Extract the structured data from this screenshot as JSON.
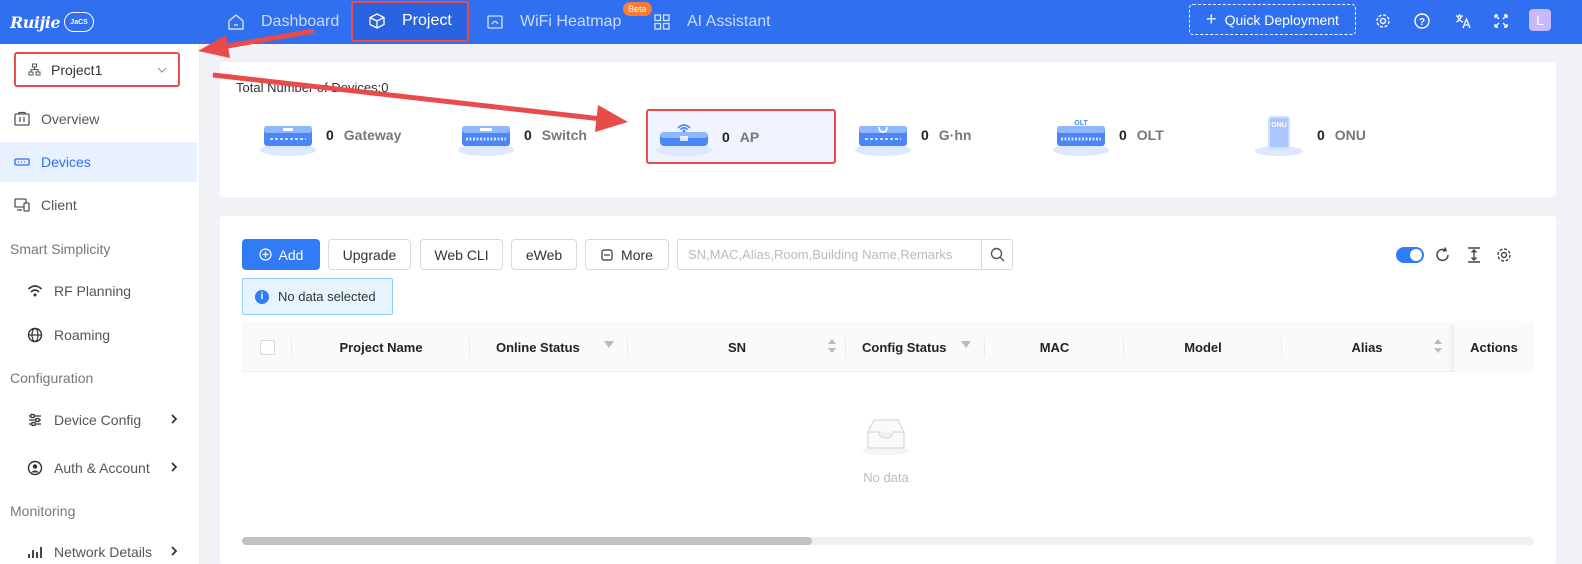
{
  "topbar": {
    "brand": "Ruijie",
    "cloud_label": "JaCS",
    "nav": [
      {
        "label": "Dashboard",
        "icon": "dashboard-icon"
      },
      {
        "label": "Project",
        "icon": "cube-icon"
      },
      {
        "label": "WiFi Heatmap",
        "icon": "heatmap-icon"
      },
      {
        "label": "AI Assistant",
        "icon": "grid-icon"
      }
    ],
    "beta_badge": "Beta",
    "quick_deployment": "Quick Deployment",
    "avatar_letter": "L"
  },
  "sidebar": {
    "project_selector": "Project1",
    "items": [
      {
        "label": "Overview",
        "icon": "overview-icon"
      },
      {
        "label": "Devices",
        "icon": "devices-icon",
        "active": true
      },
      {
        "label": "Client",
        "icon": "client-icon"
      }
    ],
    "group_smart": "Smart Simplicity",
    "smart_items": [
      {
        "label": "RF Planning",
        "icon": "wifi-icon"
      },
      {
        "label": "Roaming",
        "icon": "globe-icon"
      }
    ],
    "group_config": "Configuration",
    "config_items": [
      {
        "label": "Device Config",
        "icon": "sliders-icon"
      },
      {
        "label": "Auth & Account",
        "icon": "user-circle-icon"
      }
    ],
    "group_monitoring": "Monitoring",
    "monitoring_items": [
      {
        "label": "Network Details",
        "icon": "bar-chart-icon"
      }
    ]
  },
  "summary": {
    "total_label": "Total Number of Devices:0",
    "devices": [
      {
        "count": "0",
        "name": "Gateway"
      },
      {
        "count": "0",
        "name": "Switch"
      },
      {
        "count": "0",
        "name": "AP"
      },
      {
        "count": "0",
        "name": "G·hn"
      },
      {
        "count": "0",
        "name": "OLT"
      },
      {
        "count": "0",
        "name": "ONU"
      }
    ]
  },
  "toolbar": {
    "add": "Add",
    "upgrade": "Upgrade",
    "web_cli": "Web CLI",
    "eweb": "eWeb",
    "more": "More",
    "search_placeholder": "SN,MAC,Alias,Room,Building Name,Remarks"
  },
  "selection_info": "No data selected",
  "table": {
    "columns": [
      "Project Name",
      "Online Status",
      "SN",
      "Config Status",
      "MAC",
      "Model",
      "Alias",
      "Actions"
    ],
    "empty_text": "No data"
  },
  "colors": {
    "primary": "#2f6ff0",
    "highlight": "#e94b4b"
  }
}
